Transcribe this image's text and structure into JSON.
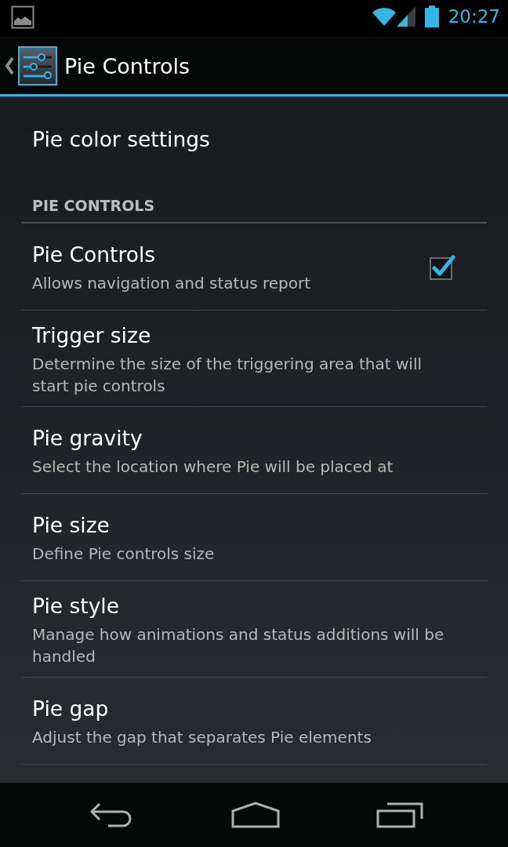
{
  "status_bar": {
    "time": "20:27"
  },
  "action_bar": {
    "title": "Pie Controls"
  },
  "preferences": [
    {
      "kind": "plain",
      "title": "Pie color settings"
    },
    {
      "kind": "category",
      "title": "PIE CONTROLS"
    },
    {
      "kind": "checkbox",
      "title": "Pie Controls",
      "summary": "Allows navigation and status report",
      "checked": true
    },
    {
      "kind": "plain",
      "title": "Trigger size",
      "summary": "Determine the size of the triggering area that will start pie controls"
    },
    {
      "kind": "plain",
      "title": "Pie gravity",
      "summary": "Select the location where Pie will be placed at"
    },
    {
      "kind": "plain",
      "title": "Pie size",
      "summary": "Define Pie controls size"
    },
    {
      "kind": "plain",
      "title": "Pie style",
      "summary": "Manage how animations and status additions will be handled"
    },
    {
      "kind": "plain",
      "title": "Pie gap",
      "summary": "Adjust the gap that separates Pie elements"
    }
  ]
}
